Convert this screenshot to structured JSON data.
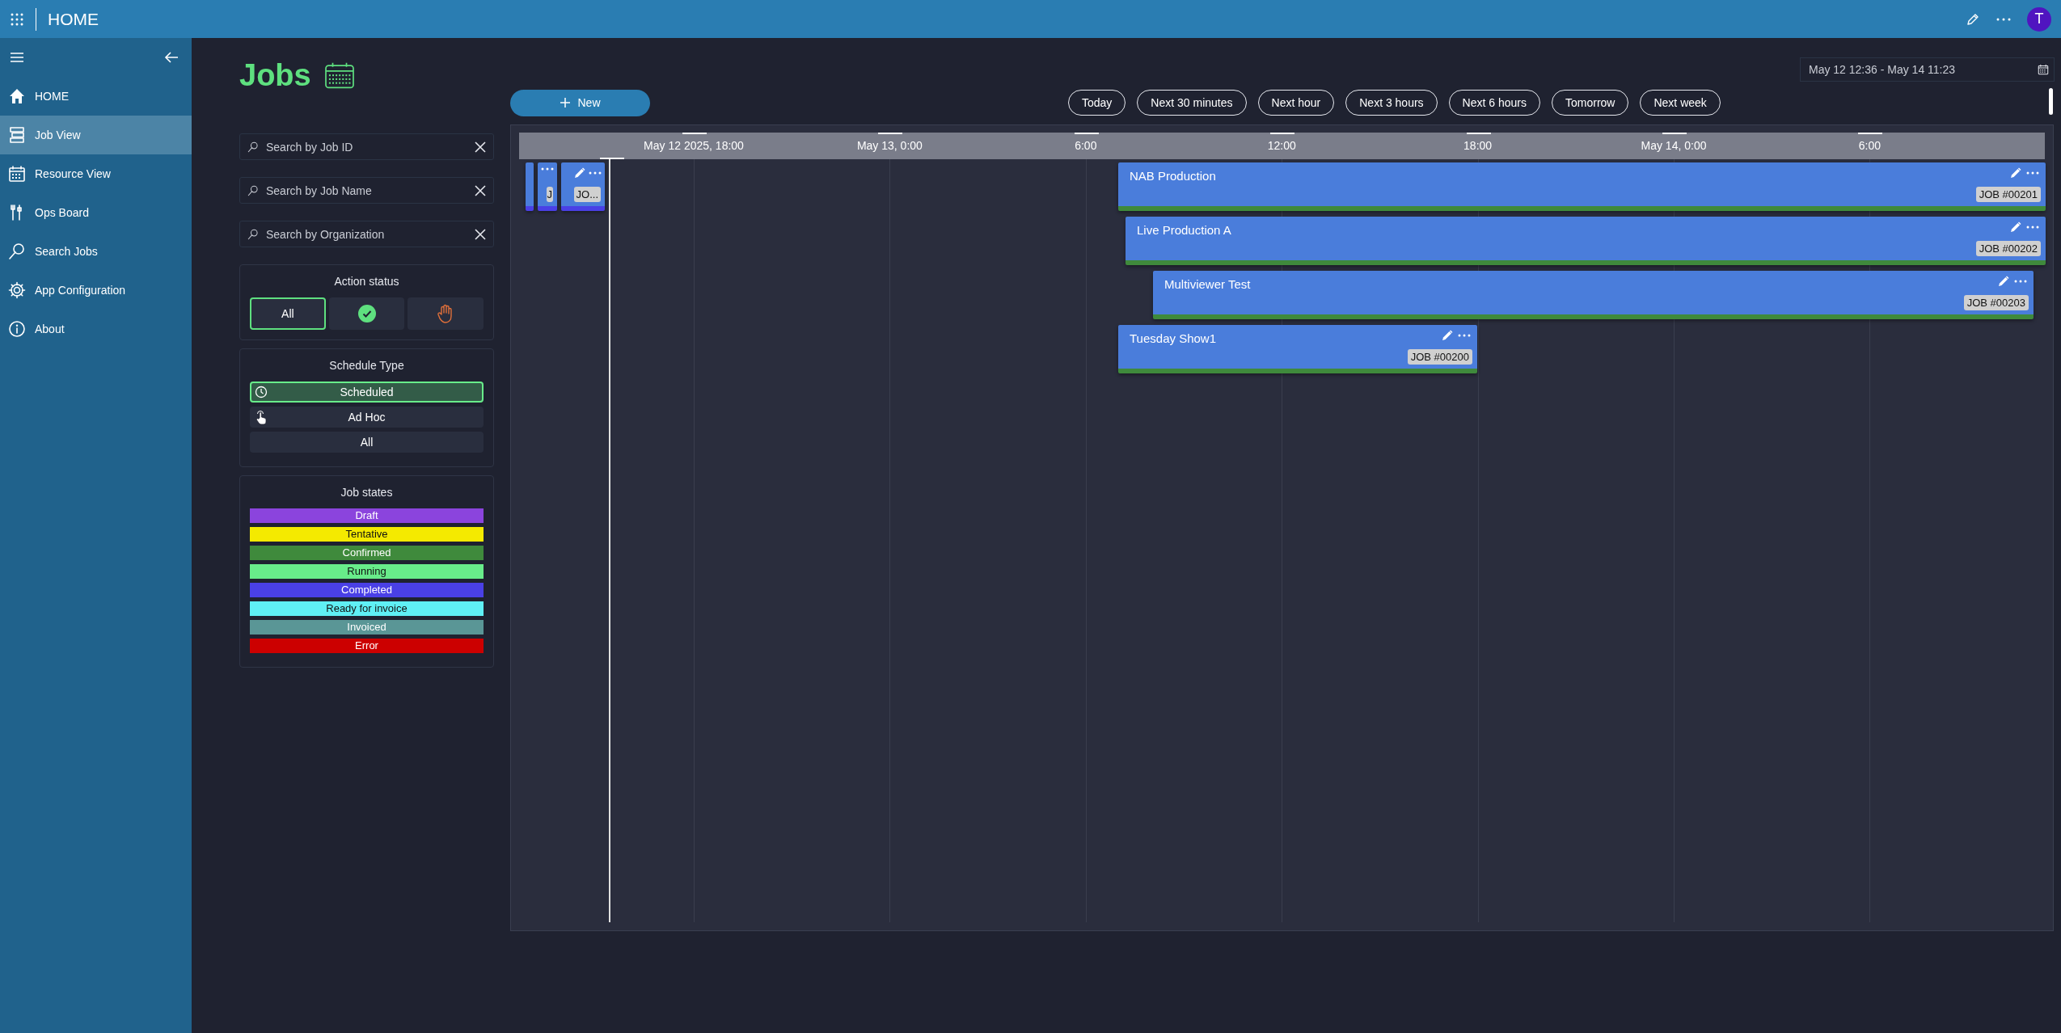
{
  "topbar": {
    "title": "HOME",
    "avatar_initial": "T"
  },
  "sidebar": {
    "items": [
      {
        "label": "HOME",
        "selected": false
      },
      {
        "label": "Job View",
        "selected": true
      },
      {
        "label": "Resource View",
        "selected": false
      },
      {
        "label": "Ops Board",
        "selected": false
      },
      {
        "label": "Search Jobs",
        "selected": false
      },
      {
        "label": "App Configuration",
        "selected": false
      },
      {
        "label": "About",
        "selected": false
      }
    ]
  },
  "page_title": "Jobs",
  "filters": {
    "search_fields": [
      {
        "placeholder": "Search by Job ID"
      },
      {
        "placeholder": "Search by Job Name"
      },
      {
        "placeholder": "Search by Organization"
      }
    ],
    "action_status": {
      "title": "Action status",
      "options": [
        {
          "kind": "text",
          "label": "All",
          "selected": true
        },
        {
          "kind": "check",
          "selected": false
        },
        {
          "kind": "hand",
          "selected": false
        }
      ]
    },
    "schedule_type": {
      "title": "Schedule Type",
      "options": [
        {
          "kind": "clock",
          "label": "Scheduled",
          "selected": true
        },
        {
          "kind": "touch",
          "label": "Ad Hoc",
          "selected": false
        },
        {
          "kind": "plain",
          "label": "All",
          "selected": false
        }
      ]
    },
    "job_states": {
      "title": "Job states",
      "items": [
        {
          "label": "Draft",
          "color": "#8b44dd"
        },
        {
          "label": "Tentative",
          "color": "#f4ea00"
        },
        {
          "label": "Confirmed",
          "color": "#3f8a3c"
        },
        {
          "label": "Running",
          "color": "#68ec8a"
        },
        {
          "label": "Completed",
          "color": "#4a40e6"
        },
        {
          "label": "Ready for invoice",
          "color": "#5ff0f5"
        },
        {
          "label": "Invoiced",
          "color": "#5a9696"
        },
        {
          "label": "Error",
          "color": "#cc0000"
        }
      ]
    }
  },
  "toolbar": {
    "new_button": "New",
    "quick_ranges": [
      "Today",
      "Next 30 minutes",
      "Next hour",
      "Next 3 hours",
      "Next 6 hours",
      "Tomorrow",
      "Next week"
    ],
    "date_range": "May 12 12:36 - May 14 11:23"
  },
  "timeline": {
    "ticks": [
      "May 12 2025, 18:00",
      "May 13, 0:00",
      "6:00",
      "12:00",
      "18:00",
      "May 14, 0:00",
      "6:00"
    ],
    "jobs": [
      {
        "kind": "stub",
        "color": "#4a40e6"
      },
      {
        "kind": "narrow",
        "badge": "J",
        "color": "#4a40e6"
      },
      {
        "kind": "compact",
        "badge": "JO...",
        "color": "#4a40e6"
      },
      {
        "kind": "full",
        "name": "NAB Production",
        "badge": "JOB #00201",
        "color": "#3f8a3c"
      },
      {
        "kind": "full",
        "name": "Live Production A",
        "badge": "JOB #00202",
        "color": "#3f8a3c"
      },
      {
        "kind": "full",
        "name": "Multiviewer Test",
        "badge": "JOB #00203",
        "color": "#3f8a3c"
      },
      {
        "kind": "full",
        "name": "Tuesday Show1",
        "badge": "JOB #00200",
        "color": "#3f8a3c"
      }
    ]
  }
}
